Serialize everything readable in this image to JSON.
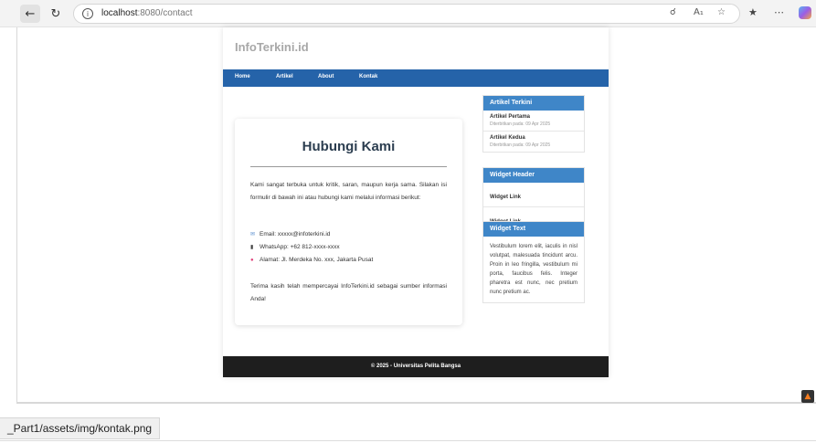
{
  "browser": {
    "back_icon": "arrow-left-icon",
    "reload_icon": "reload-icon",
    "url_host": "localhost",
    "url_path": ":8080/contact",
    "zoom_icon": "zoom-icon",
    "read_aloud_icon": "read-aloud-icon",
    "favorite_icon": "star-icon",
    "favorites_icon": "favorites-icon",
    "more_icon": "more-icon",
    "copilot_icon": "copilot-icon"
  },
  "site": {
    "brand": "InfoTerkini.id",
    "nav": [
      "Home",
      "Artikel",
      "About",
      "Kontak"
    ],
    "accent_color": "#2563a9"
  },
  "contact": {
    "title": "Hubungi Kami",
    "intro": "Kami sangat terbuka untuk kritik, saran, maupun kerja sama. Silakan isi formulir di bawah ini atau hubungi kami melalui informasi berikut:",
    "email": "Email: xxxxx@infoterkini.id",
    "whatsapp": "WhatsApp: +62 812-xxxx-xxxx",
    "address": "Alamat: Jl. Merdeka No. xxx, Jakarta Pusat",
    "closing": "Terima kasih telah mempercayai InfoTerkini.id sebagai sumber informasi Anda!"
  },
  "sidebar": {
    "latest": {
      "header": "Artikel Terkini",
      "items": [
        {
          "title": "Artikel Pertama",
          "date": "Diterbitkan pada: 09 Apr 2025"
        },
        {
          "title": "Artikel Kedua",
          "date": "Diterbitkan pada: 09 Apr 2025"
        }
      ]
    },
    "links": {
      "header": "Widget Header",
      "items": [
        "Widget Link",
        "Widget Link"
      ]
    },
    "text": {
      "header": "Widget Text",
      "body": "Vestibulum lorem elit, iaculis in nisl volutpat, malesuada tincidunt arcu. Proin in leo fringilla, vestibulum mi porta, faucibus felis. Integer pharetra est nunc, nec pretium nunc pretium ac."
    }
  },
  "footer": "© 2025 - Universitas Pelita Bangsa",
  "status_bar": "_Part1/assets/img/kontak.png"
}
